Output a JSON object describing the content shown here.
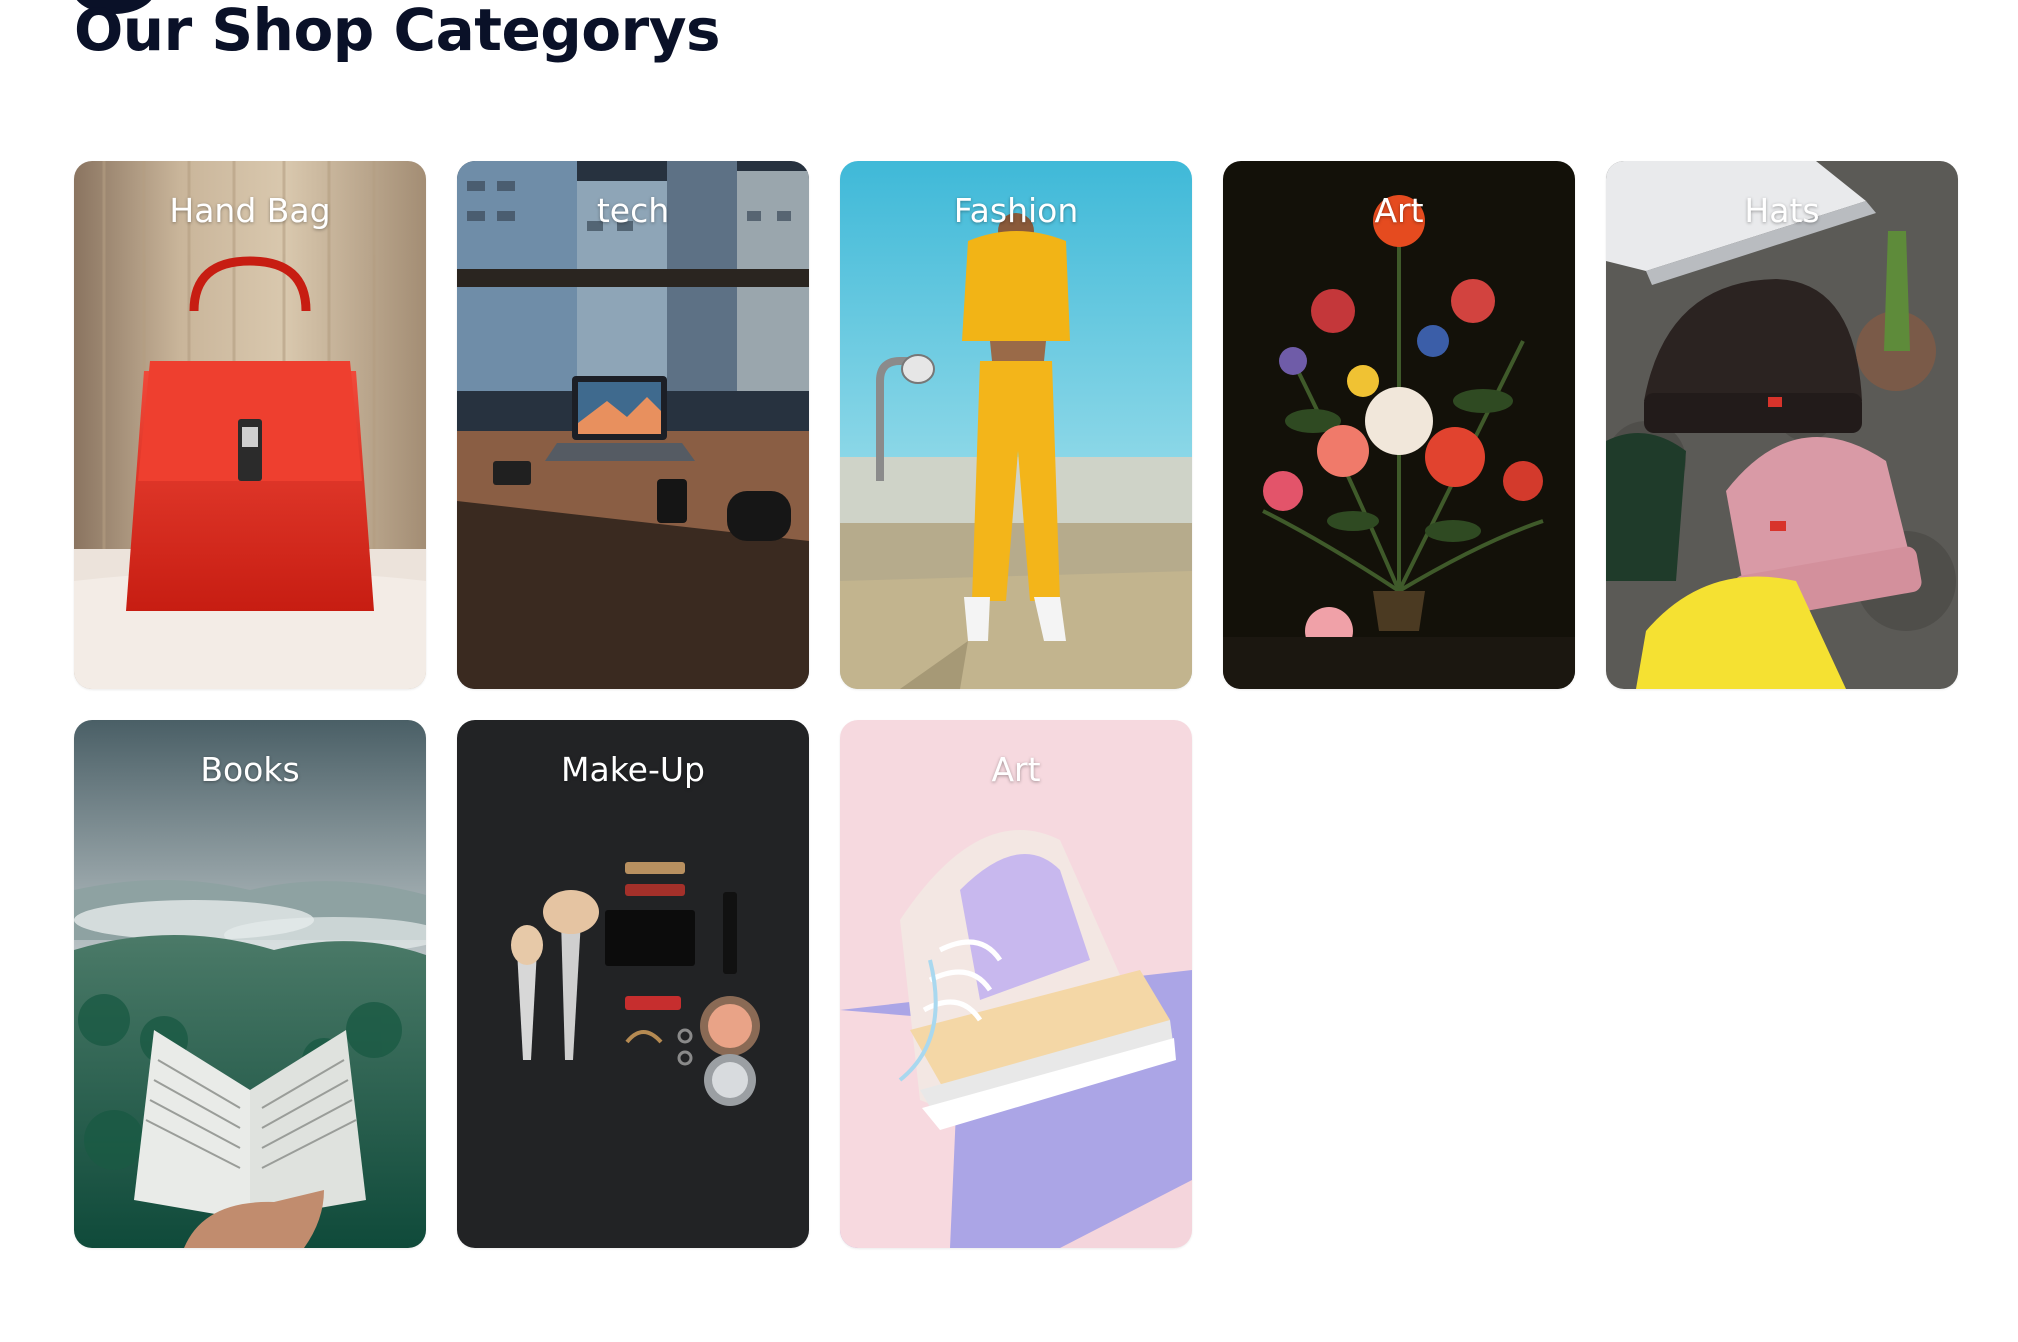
{
  "section": {
    "title": "Our Shop Categorys"
  },
  "categories": [
    {
      "label": "Hand Bag",
      "art": "red-handbag-image"
    },
    {
      "label": "tech",
      "art": "laptop-desk-city-image"
    },
    {
      "label": "Fashion",
      "art": "yellow-tracksuit-model-image"
    },
    {
      "label": "Art",
      "art": "flower-still-life-painting-image"
    },
    {
      "label": "Hats",
      "art": "knit-beanies-image"
    },
    {
      "label": "Books",
      "art": "open-book-misty-forest-image"
    },
    {
      "label": "Make-Up",
      "art": "makeup-flatlay-image"
    },
    {
      "label": "Art",
      "art": "pastel-sneaker-image"
    }
  ],
  "colors": {
    "title": "#0a1128",
    "label": "#ffffff",
    "background": "#ffffff"
  }
}
